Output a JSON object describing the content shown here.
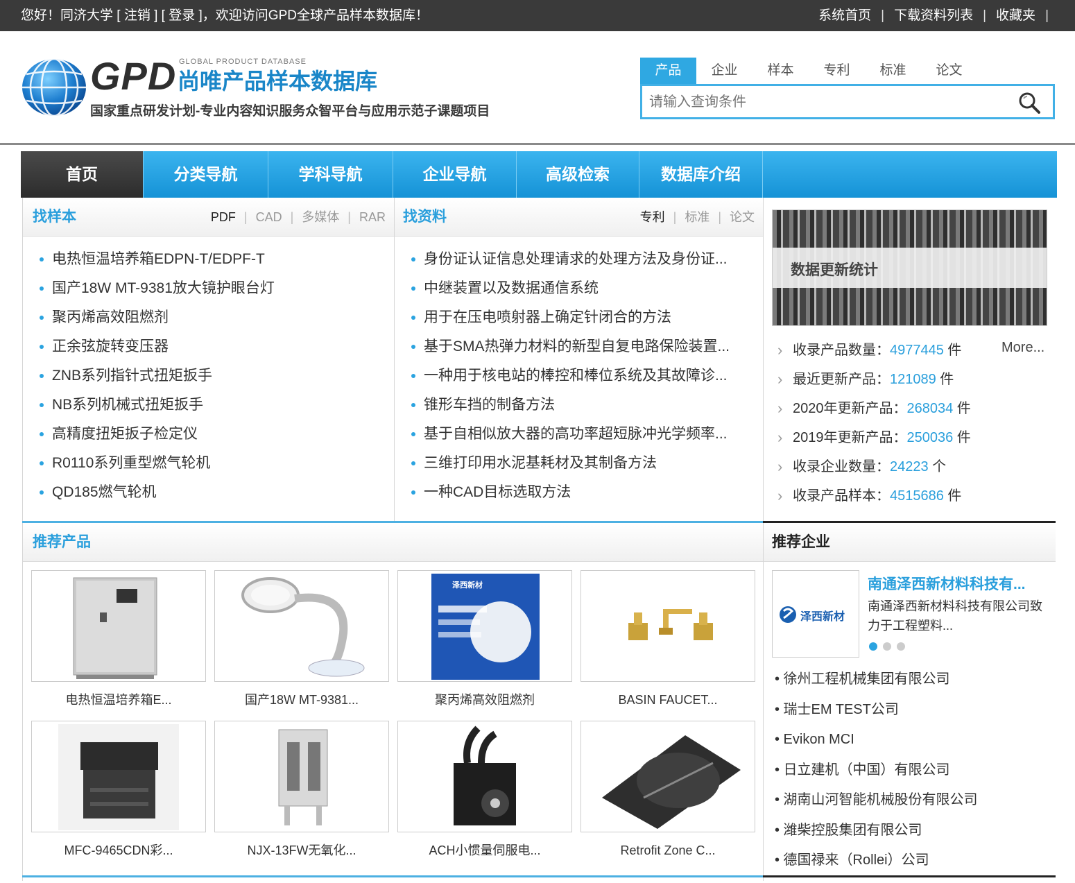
{
  "topbar": {
    "welcome": "您好！同济大学 [ 注销 ] [ 登录 ]，欢迎访问GPD全球产品样本数据库！",
    "links": [
      "系统首页",
      "下载资料列表",
      "收藏夹"
    ],
    "separator": "|"
  },
  "header": {
    "logo_mark": "GPD",
    "logo_sub": "GLOBAL PRODUCT DATABASE",
    "logo_title": "尚唯产品样本数据库",
    "slogan": "国家重点研发计划-专业内容知识服务众智平台与应用示范子课题项目"
  },
  "search": {
    "tabs": [
      "产品",
      "企业",
      "样本",
      "专利",
      "标准",
      "论文"
    ],
    "active_tab": "产品",
    "placeholder": "请输入查询条件"
  },
  "nav": {
    "items": [
      "首页",
      "分类导航",
      "学科导航",
      "企业导航",
      "高级检索",
      "数据库介绍"
    ],
    "active": "首页"
  },
  "samples": {
    "title": "找样本",
    "filters": [
      "PDF",
      "CAD",
      "多媒体",
      "RAR"
    ],
    "items": [
      "电热恒温培养箱EDPN-T/EDPF-T",
      "国产18W MT-9381放大镜护眼台灯",
      "聚丙烯高效阻燃剂",
      "正余弦旋转变压器",
      "ZNB系列指针式扭矩扳手",
      "NB系列机械式扭矩扳手",
      "高精度扭矩扳子检定仪",
      "R0110系列重型燃气轮机",
      "QD185燃气轮机"
    ]
  },
  "materials": {
    "title": "找资料",
    "filters": [
      "专利",
      "标准",
      "论文"
    ],
    "items": [
      "身份证认证信息处理请求的处理方法及身份证...",
      "中继装置以及数据通信系统",
      "用于在压电喷射器上确定针闭合的方法",
      "基于SMA热弹力材料的新型自复电路保险装置...",
      "一种用于核电站的棒控和棒位系统及其故障诊...",
      "锥形车挡的制备方法",
      "基于自相似放大器的高功率超短脉冲光学频率...",
      "三维打印用水泥基耗材及其制备方法",
      "一种CAD目标选取方法"
    ]
  },
  "stats": {
    "banner_label": "数据更新统计",
    "more": "More...",
    "rows": [
      {
        "label": "收录产品数量：",
        "value": "4977445",
        "unit": " 件"
      },
      {
        "label": "最近更新产品：",
        "value": "121089",
        "unit": " 件"
      },
      {
        "label": "2020年更新产品：",
        "value": "268034",
        "unit": " 件"
      },
      {
        "label": "2019年更新产品：",
        "value": "250036",
        "unit": " 件"
      },
      {
        "label": "收录企业数量：",
        "value": "24223",
        "unit": " 个"
      },
      {
        "label": "收录产品样本：",
        "value": "4515686",
        "unit": " 件"
      }
    ]
  },
  "products": {
    "title": "推荐产品",
    "items": [
      {
        "caption": "电热恒温培养箱E...",
        "icon": "incubator-image"
      },
      {
        "caption": "国产18W MT-9381...",
        "icon": "magnifier-lamp-image"
      },
      {
        "caption": "聚丙烯高效阻燃剂",
        "icon": "flame-retardant-image",
        "image_text": "泽西新材"
      },
      {
        "caption": "BASIN FAUCET...",
        "icon": "faucet-image"
      },
      {
        "caption": "MFC-9465CDN彩...",
        "icon": "printer-image"
      },
      {
        "caption": "NJX-13FW无氧化...",
        "icon": "relay-image"
      },
      {
        "caption": "ACH小惯量伺服电...",
        "icon": "servo-motor-image"
      },
      {
        "caption": "Retrofit Zone C...",
        "icon": "damper-image"
      }
    ]
  },
  "enterprises": {
    "title": "推荐企业",
    "featured": {
      "logo_text": "泽西新材",
      "name": "南通泽西新材料科技有...",
      "desc": "南通泽西新材料科技有限公司致力于工程塑料..."
    },
    "items": [
      "• 徐州工程机械集团有限公司",
      "• 瑞士EM TEST公司",
      "• Evikon MCI",
      "• 日立建机（中国）有限公司",
      "• 湖南山河智能机械股份有限公司",
      "• 潍柴控股集团有限公司",
      "• 德国禄来（Rollei）公司"
    ]
  },
  "colors": {
    "accent": "#2a9fdc",
    "nav_start": "#3bb4ef",
    "nav_end": "#1592d6",
    "topbar": "#3a3a3a"
  }
}
